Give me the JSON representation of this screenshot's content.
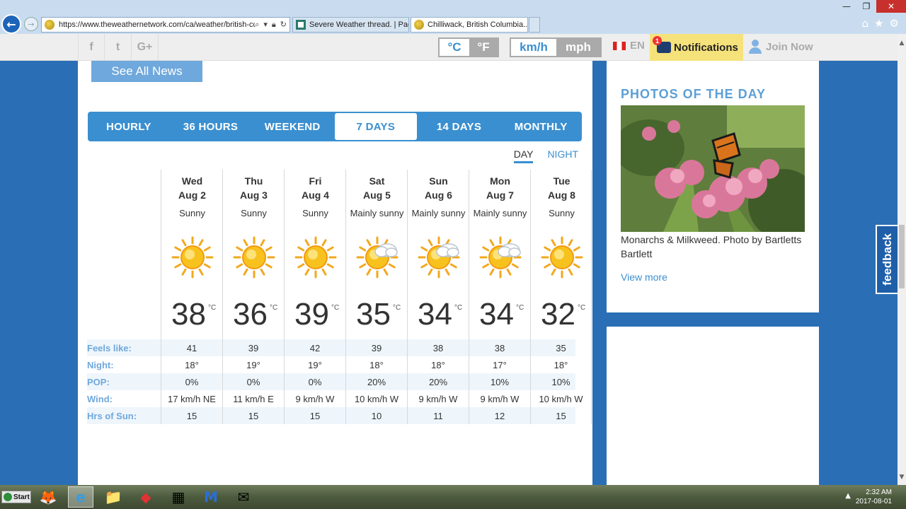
{
  "browser": {
    "url": "https://www.theweathernetwork.com/ca/weather/british-cc",
    "tabs": [
      {
        "title": "Severe Weather thread. | Page ..."
      },
      {
        "title": "Chilliwack, British Columbia..."
      }
    ],
    "window_buttons": {
      "minimize": "—",
      "restore": "❐",
      "close": "✕"
    }
  },
  "site_header": {
    "social": [
      "f",
      "t",
      "G+"
    ],
    "temp_units": {
      "active": "°C",
      "inactive": "°F"
    },
    "speed_units": {
      "active": "km/h",
      "inactive": "mph"
    },
    "language": "EN",
    "notifications_label": "Notifications",
    "notifications_count": "1",
    "join_label": "Join Now"
  },
  "main": {
    "see_all_news": "See All News",
    "tabs": [
      {
        "label": "HOURLY"
      },
      {
        "label": "36 HOURS"
      },
      {
        "label": "WEEKEND"
      },
      {
        "label": "7 DAYS",
        "active": true
      },
      {
        "label": "14 DAYS"
      },
      {
        "label": "MONTHLY"
      }
    ],
    "day_label": "DAY",
    "night_label": "NIGHT",
    "temp_unit": "°C",
    "row_labels": {
      "feels": "Feels like:",
      "night": "Night:",
      "pop": "POP:",
      "wind": "Wind:",
      "sun": "Hrs of Sun:"
    },
    "days": [
      {
        "day": "Wed",
        "date": "Aug 2",
        "condition": "Sunny",
        "icon": "sun-icon",
        "temp": "38",
        "feels": "41",
        "night": "18°",
        "pop": "0%",
        "wind": "17 km/h NE",
        "sun": "15"
      },
      {
        "day": "Thu",
        "date": "Aug 3",
        "condition": "Sunny",
        "icon": "sun-icon",
        "temp": "36",
        "feels": "39",
        "night": "19°",
        "pop": "0%",
        "wind": "11 km/h E",
        "sun": "15"
      },
      {
        "day": "Fri",
        "date": "Aug 4",
        "condition": "Sunny",
        "icon": "sun-icon",
        "temp": "39",
        "feels": "42",
        "night": "19°",
        "pop": "0%",
        "wind": "9 km/h W",
        "sun": "15"
      },
      {
        "day": "Sat",
        "date": "Aug 5",
        "condition": "Mainly sunny",
        "icon": "sun-cloud-icon",
        "temp": "35",
        "feels": "39",
        "night": "18°",
        "pop": "20%",
        "wind": "10 km/h W",
        "sun": "10"
      },
      {
        "day": "Sun",
        "date": "Aug 6",
        "condition": "Mainly sunny",
        "icon": "sun-cloud-icon",
        "temp": "34",
        "feels": "38",
        "night": "18°",
        "pop": "20%",
        "wind": "9 km/h W",
        "sun": "11"
      },
      {
        "day": "Mon",
        "date": "Aug 7",
        "condition": "Mainly sunny",
        "icon": "sun-cloud-icon",
        "temp": "34",
        "feels": "38",
        "night": "17°",
        "pop": "10%",
        "wind": "9 km/h W",
        "sun": "12"
      },
      {
        "day": "Tue",
        "date": "Aug 8",
        "condition": "Sunny",
        "icon": "sun-icon",
        "temp": "32",
        "feels": "35",
        "night": "18°",
        "pop": "10%",
        "wind": "10 km/h W",
        "sun": "15"
      }
    ]
  },
  "sidebar": {
    "photos_title": "PHOTOS OF THE DAY",
    "caption": "Monarchs & Milkweed. Photo by Bartletts Bartlett",
    "view_more": "View more",
    "feedback": "feedback"
  },
  "taskbar": {
    "start": "Start",
    "time": "2:32 AM",
    "date": "2017-08-01"
  },
  "colors": {
    "accent": "#3a8fd0",
    "page_bg": "#2a6fb5",
    "notif_bg": "#f6e27a"
  }
}
